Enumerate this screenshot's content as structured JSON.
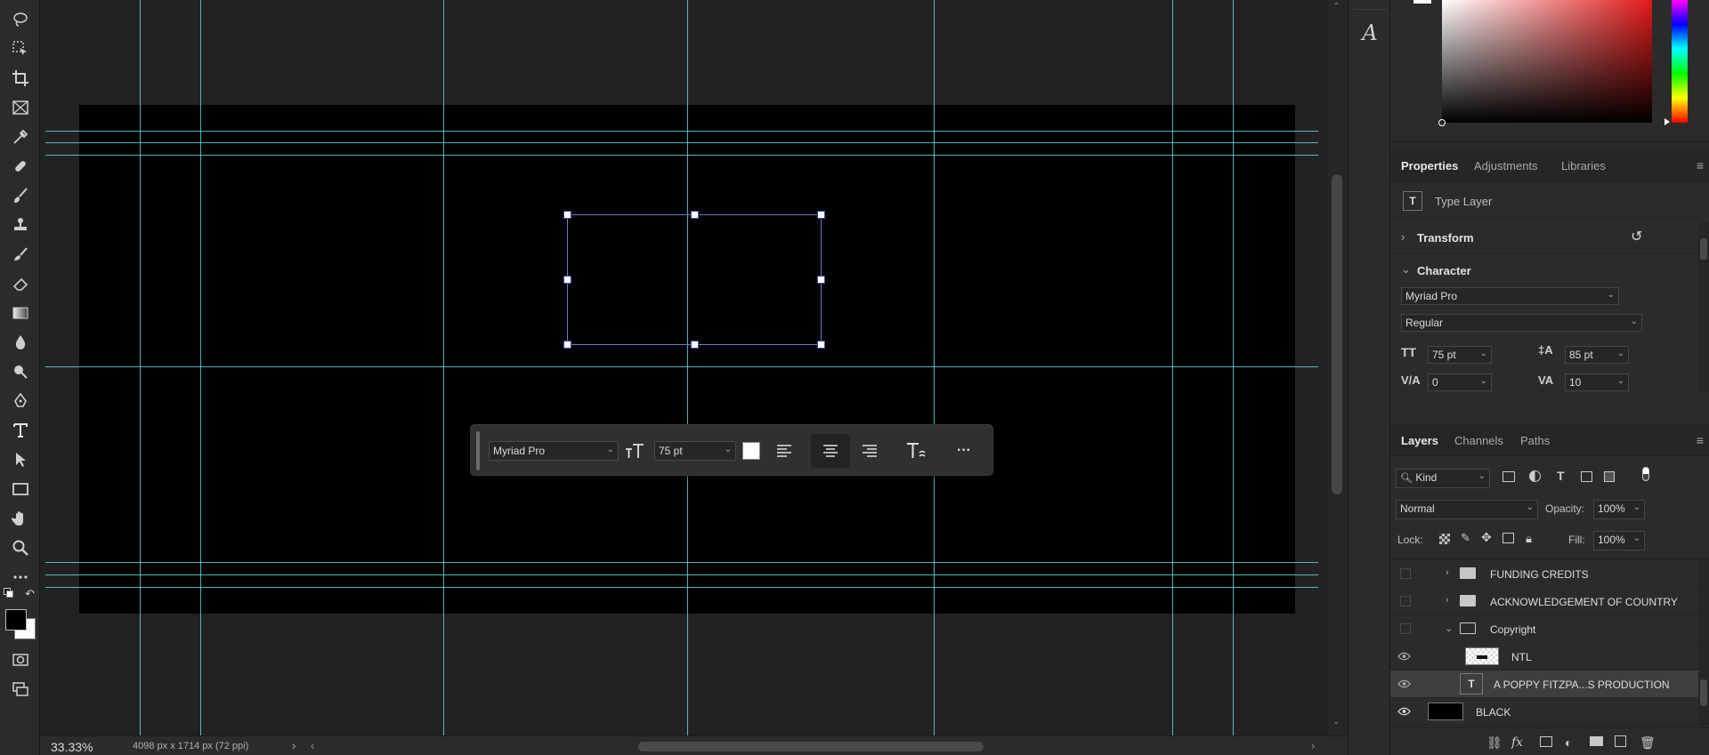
{
  "toolbar": {
    "tools": [
      "lasso-icon",
      "object-selection-icon",
      "crop-icon",
      "frame-icon",
      "eyedropper-icon",
      "healing-brush-icon",
      "brush-icon",
      "clone-stamp-icon",
      "history-brush-icon",
      "eraser-icon",
      "gradient-icon",
      "blur-icon",
      "dodge-icon",
      "pen-icon",
      "type-icon",
      "path-selection-icon",
      "rectangle-icon",
      "hand-icon",
      "zoom-icon",
      "more-tools-icon"
    ],
    "foreground_color": "#000000",
    "background_color": "#ffffff"
  },
  "status": {
    "zoom": "33.33%",
    "doc_info": "4098 px x 1714 px (72 ppi)",
    "arrow": "›"
  },
  "taskbar": {
    "font_family": "Myriad Pro",
    "font_size": "75 pt",
    "text_color": "#ffffff",
    "more": "···"
  },
  "midstrip": {
    "glyphs_label": "A"
  },
  "properties": {
    "tabs": [
      "Properties",
      "Adjustments",
      "Libraries"
    ],
    "layer_type": "Type Layer",
    "transform_label": "Transform",
    "character_label": "Character",
    "font_family": "Myriad Pro",
    "font_style": "Regular",
    "font_size": "75 pt",
    "leading": "85 pt",
    "kerning": "0",
    "tracking": "10"
  },
  "layers": {
    "tabs": [
      "Layers",
      "Channels",
      "Paths"
    ],
    "filter_kind": "Kind",
    "blend_mode": "Normal",
    "opacity_label": "Opacity:",
    "opacity": "100%",
    "lock_label": "Lock:",
    "fill_label": "Fill:",
    "fill": "100%",
    "items": [
      {
        "name": "FUNDING CREDITS",
        "type": "group",
        "visible": false,
        "expanded": false
      },
      {
        "name": "ACKNOWLEDGEMENT OF COUNTRY",
        "type": "group",
        "visible": false,
        "expanded": false
      },
      {
        "name": "Copyright",
        "type": "group",
        "visible": false,
        "expanded": true
      },
      {
        "name": "NTL",
        "type": "image",
        "visible": true
      },
      {
        "name": "A POPPY FITZPA...S PRODUCTION",
        "type": "text",
        "visible": true,
        "selected": true
      },
      {
        "name": "BLACK",
        "type": "fill",
        "visible": true
      }
    ],
    "footer": [
      "link-icon",
      "fx-icon",
      "mask-icon",
      "adjustment-icon",
      "group-icon",
      "new-layer-icon",
      "trash-icon"
    ]
  }
}
